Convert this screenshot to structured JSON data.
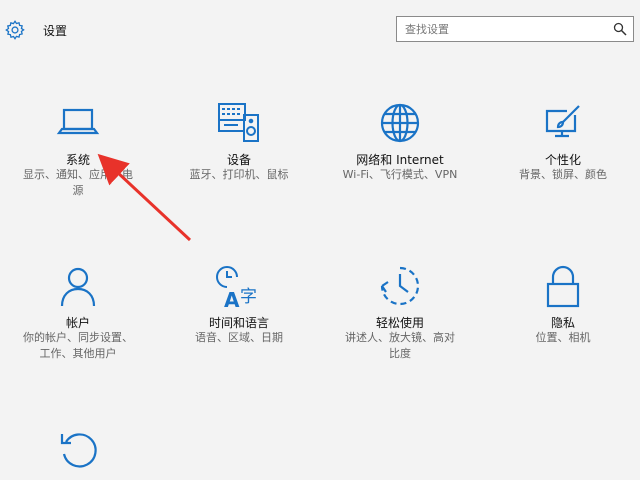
{
  "window": {
    "title": "设置"
  },
  "search": {
    "placeholder": "查找设置"
  },
  "colors": {
    "accent": "#1a73c6",
    "annotation_arrow": "#e8322a"
  },
  "tiles": [
    {
      "id": "system",
      "icon": "laptop-icon",
      "name": "系统",
      "desc": "显示、通知、应用、电\n源"
    },
    {
      "id": "devices",
      "icon": "keyboard-speaker-icon",
      "name": "设备",
      "desc": "蓝牙、打印机、鼠标"
    },
    {
      "id": "network",
      "icon": "globe-icon",
      "name": "网络和 Internet",
      "desc": "Wi-Fi、飞行模式、VPN"
    },
    {
      "id": "personalization",
      "icon": "paint-brush-monitor-icon",
      "name": "个性化",
      "desc": "背景、锁屏、颜色"
    },
    {
      "id": "accounts",
      "icon": "person-icon",
      "name": "帐户",
      "desc": "你的帐户、同步设置、\n工作、其他用户"
    },
    {
      "id": "time-language",
      "icon": "clock-language-icon",
      "name": "时间和语言",
      "desc": "语音、区域、日期"
    },
    {
      "id": "ease-of-access",
      "icon": "ease-of-access-icon",
      "name": "轻松使用",
      "desc": "讲述人、放大镜、高对\n比度"
    },
    {
      "id": "privacy",
      "icon": "lock-icon",
      "name": "隐私",
      "desc": "位置、相机"
    },
    {
      "id": "update-security",
      "icon": "refresh-icon",
      "name": "",
      "desc": ""
    }
  ]
}
